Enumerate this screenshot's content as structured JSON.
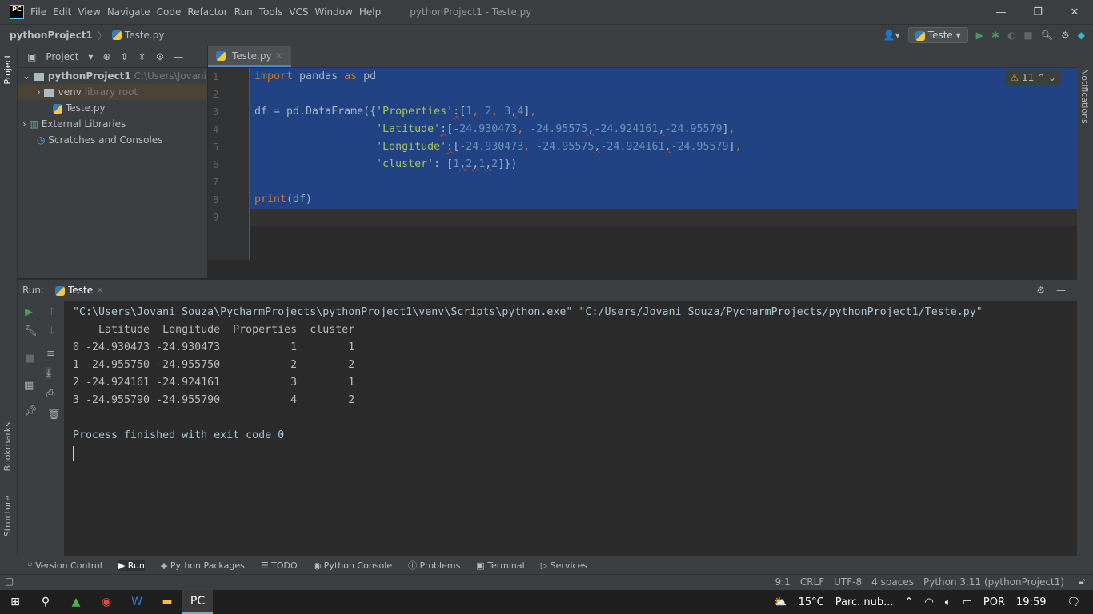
{
  "title_bar": {
    "logo": "PC",
    "menu": [
      "File",
      "Edit",
      "View",
      "Navigate",
      "Code",
      "Refactor",
      "Run",
      "Tools",
      "VCS",
      "Window",
      "Help"
    ],
    "title": "pythonProject1 - Teste.py"
  },
  "nav": {
    "project": "pythonProject1",
    "file": "Teste.py",
    "run_config": "Teste"
  },
  "left_stripe": {
    "project": "Project",
    "bookmarks": "Bookmarks",
    "structure": "Structure"
  },
  "right_stripe": {
    "notifications": "Notifications"
  },
  "project_panel": {
    "title": "Project",
    "tree": [
      {
        "label": "pythonProject1",
        "hint": "C:\\Users\\Jovani Sou"
      },
      {
        "label": "venv",
        "hint": "library root"
      },
      {
        "label": "Teste.py",
        "hint": ""
      },
      {
        "label": "External Libraries",
        "hint": ""
      },
      {
        "label": "Scratches and Consoles",
        "hint": ""
      }
    ]
  },
  "editor": {
    "tab": "Teste.py",
    "warnings": "11",
    "line_numbers": [
      "1",
      "2",
      "3",
      "4",
      "5",
      "6",
      "7",
      "8",
      "9"
    ],
    "lines": [
      [
        [
          "kw",
          "import"
        ],
        [
          "id",
          " pandas "
        ],
        [
          "kw",
          "as"
        ],
        [
          "id",
          " pd"
        ]
      ],
      [],
      [
        [
          "id",
          "df = pd.DataFrame({"
        ],
        [
          "str",
          "'Properties'"
        ],
        [
          "err",
          ":"
        ],
        [
          "id",
          "["
        ],
        [
          "num",
          "1"
        ],
        [
          "kw",
          ", "
        ],
        [
          "num",
          "2"
        ],
        [
          "kw",
          ", "
        ],
        [
          "num",
          "3"
        ],
        [
          "err",
          ","
        ],
        [
          "num",
          "4"
        ],
        [
          "id",
          "]"
        ],
        [
          "kw",
          ","
        ]
      ],
      [
        [
          "id",
          "                   "
        ],
        [
          "str",
          "'Latitude'"
        ],
        [
          "err",
          ":"
        ],
        [
          "id",
          "["
        ],
        [
          "num",
          "-24.930473"
        ],
        [
          "kw",
          ", "
        ],
        [
          "num",
          "-24.95575"
        ],
        [
          "err",
          ","
        ],
        [
          "num",
          "-24.924161"
        ],
        [
          "err",
          ","
        ],
        [
          "num",
          "-24.95579"
        ],
        [
          "id",
          "]"
        ],
        [
          "kw",
          ","
        ]
      ],
      [
        [
          "id",
          "                   "
        ],
        [
          "str",
          "'Longitude'"
        ],
        [
          "err",
          ":"
        ],
        [
          "id",
          "["
        ],
        [
          "num",
          "-24.930473"
        ],
        [
          "kw",
          ", "
        ],
        [
          "num",
          "-24.95575"
        ],
        [
          "err",
          ","
        ],
        [
          "num",
          "-24.924161"
        ],
        [
          "err",
          ","
        ],
        [
          "num",
          "-24.95579"
        ],
        [
          "id",
          "]"
        ],
        [
          "kw",
          ","
        ]
      ],
      [
        [
          "id",
          "                   "
        ],
        [
          "str",
          "'cluster'"
        ],
        [
          "id",
          ": ["
        ],
        [
          "num",
          "1"
        ],
        [
          "err",
          ","
        ],
        [
          "num",
          "2"
        ],
        [
          "err",
          ","
        ],
        [
          "num",
          "1"
        ],
        [
          "err",
          ","
        ],
        [
          "num",
          "2"
        ],
        [
          "id",
          "]})"
        ]
      ],
      [],
      [
        [
          "kw",
          "print"
        ],
        [
          "id",
          "(df)"
        ]
      ],
      []
    ]
  },
  "run_panel": {
    "label": "Run:",
    "tab": "Teste",
    "output": [
      "\"C:\\Users\\Jovani Souza\\PycharmProjects\\pythonProject1\\venv\\Scripts\\python.exe\" \"C:/Users/Jovani Souza/PycharmProjects/pythonProject1/Teste.py\"",
      "    Latitude  Longitude  Properties  cluster",
      "0 -24.930473 -24.930473           1        1",
      "1 -24.955750 -24.955750           2        2",
      "2 -24.924161 -24.924161           3        1",
      "3 -24.955790 -24.955790           4        2",
      "",
      "Process finished with exit code 0"
    ]
  },
  "tool_tabs": [
    "Version Control",
    "Run",
    "Python Packages",
    "TODO",
    "Python Console",
    "Problems",
    "Terminal",
    "Services"
  ],
  "status_bar": {
    "position": "9:1",
    "line_sep": "CRLF",
    "encoding": "UTF-8",
    "indent": "4 spaces",
    "interpreter": "Python 3.11 (pythonProject1)"
  },
  "taskbar": {
    "temp": "15°C",
    "weather": "Parc. nub...",
    "lang": "POR",
    "time": "19:59"
  }
}
